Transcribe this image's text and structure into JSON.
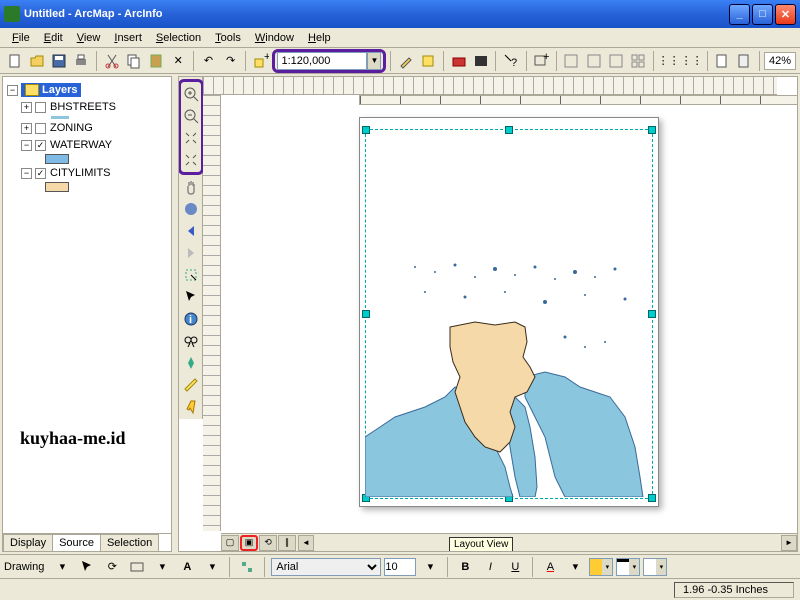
{
  "window": {
    "title": "Untitled - ArcMap - ArcInfo"
  },
  "menu": {
    "file": "File",
    "edit": "Edit",
    "view": "View",
    "insert": "Insert",
    "selection": "Selection",
    "tools": "Tools",
    "window": "Window",
    "help": "Help"
  },
  "toolbar": {
    "scale": "1:120,000",
    "zoom_pct": "42%"
  },
  "toc": {
    "root": "Layers",
    "items": [
      {
        "name": "BHSTREETS",
        "checked": false,
        "expanded": false,
        "swatch": "#8ac6de"
      },
      {
        "name": "ZONING",
        "checked": false,
        "expanded": false
      },
      {
        "name": "WATERWAY",
        "checked": true,
        "expanded": true,
        "swatch": "#7fb9e5"
      },
      {
        "name": "CITYLIMITS",
        "checked": true,
        "expanded": true,
        "swatch": "#f5d9a8"
      }
    ],
    "tabs": {
      "display": "Display",
      "source": "Source",
      "selection": "Selection"
    }
  },
  "drawing": {
    "label": "Drawing",
    "font": "Arial",
    "size": "10",
    "bold": "B",
    "italic": "I",
    "underline": "U"
  },
  "status": {
    "coords": "1.96 -0.35 Inches"
  },
  "tooltip": {
    "layout_view": "Layout View"
  },
  "watermark": "kuyhaa-me.id"
}
